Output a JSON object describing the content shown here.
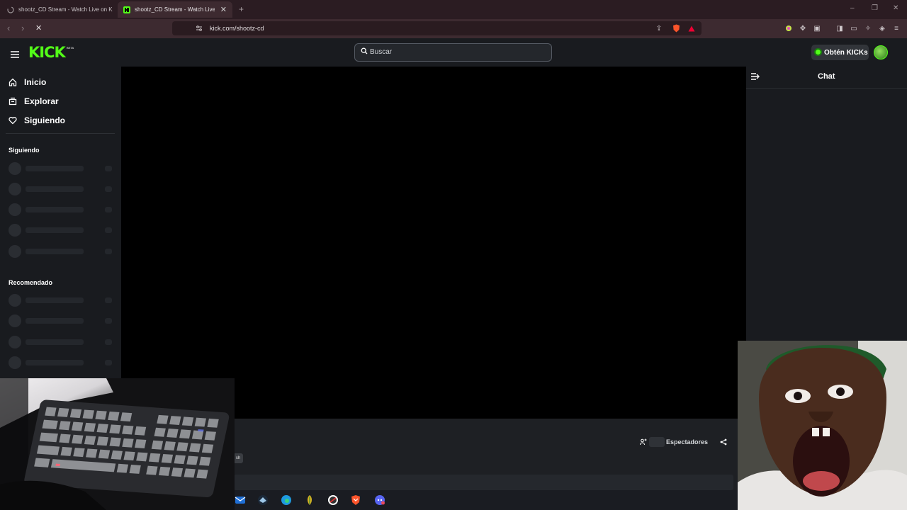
{
  "browser": {
    "tabs": [
      {
        "title": "shootz_CD Stream - Watch Live on K",
        "active": false
      },
      {
        "title": "shootz_CD Stream - Watch Live",
        "active": true
      }
    ],
    "new_tab": "+",
    "url": "kick.com/shootz-cd"
  },
  "header": {
    "logo": "KICK",
    "logo_badge": "BETA",
    "search_placeholder": "Buscar",
    "kicks_button": "Obtén KICKs"
  },
  "sidebar": {
    "nav": [
      {
        "label": "Inicio",
        "icon": "home-icon"
      },
      {
        "label": "Explorar",
        "icon": "explore-icon"
      },
      {
        "label": "Siguiendo",
        "icon": "heart-icon"
      }
    ],
    "following_title": "Siguiendo",
    "recommended_title": "Recomendado"
  },
  "stream": {
    "viewers_label": "Espectadores",
    "mini_label": "sh"
  },
  "chat": {
    "title": "Chat"
  },
  "colors": {
    "brand": "#53fc18",
    "background": "#191b1f",
    "browser_chrome": "#3d2a30"
  }
}
